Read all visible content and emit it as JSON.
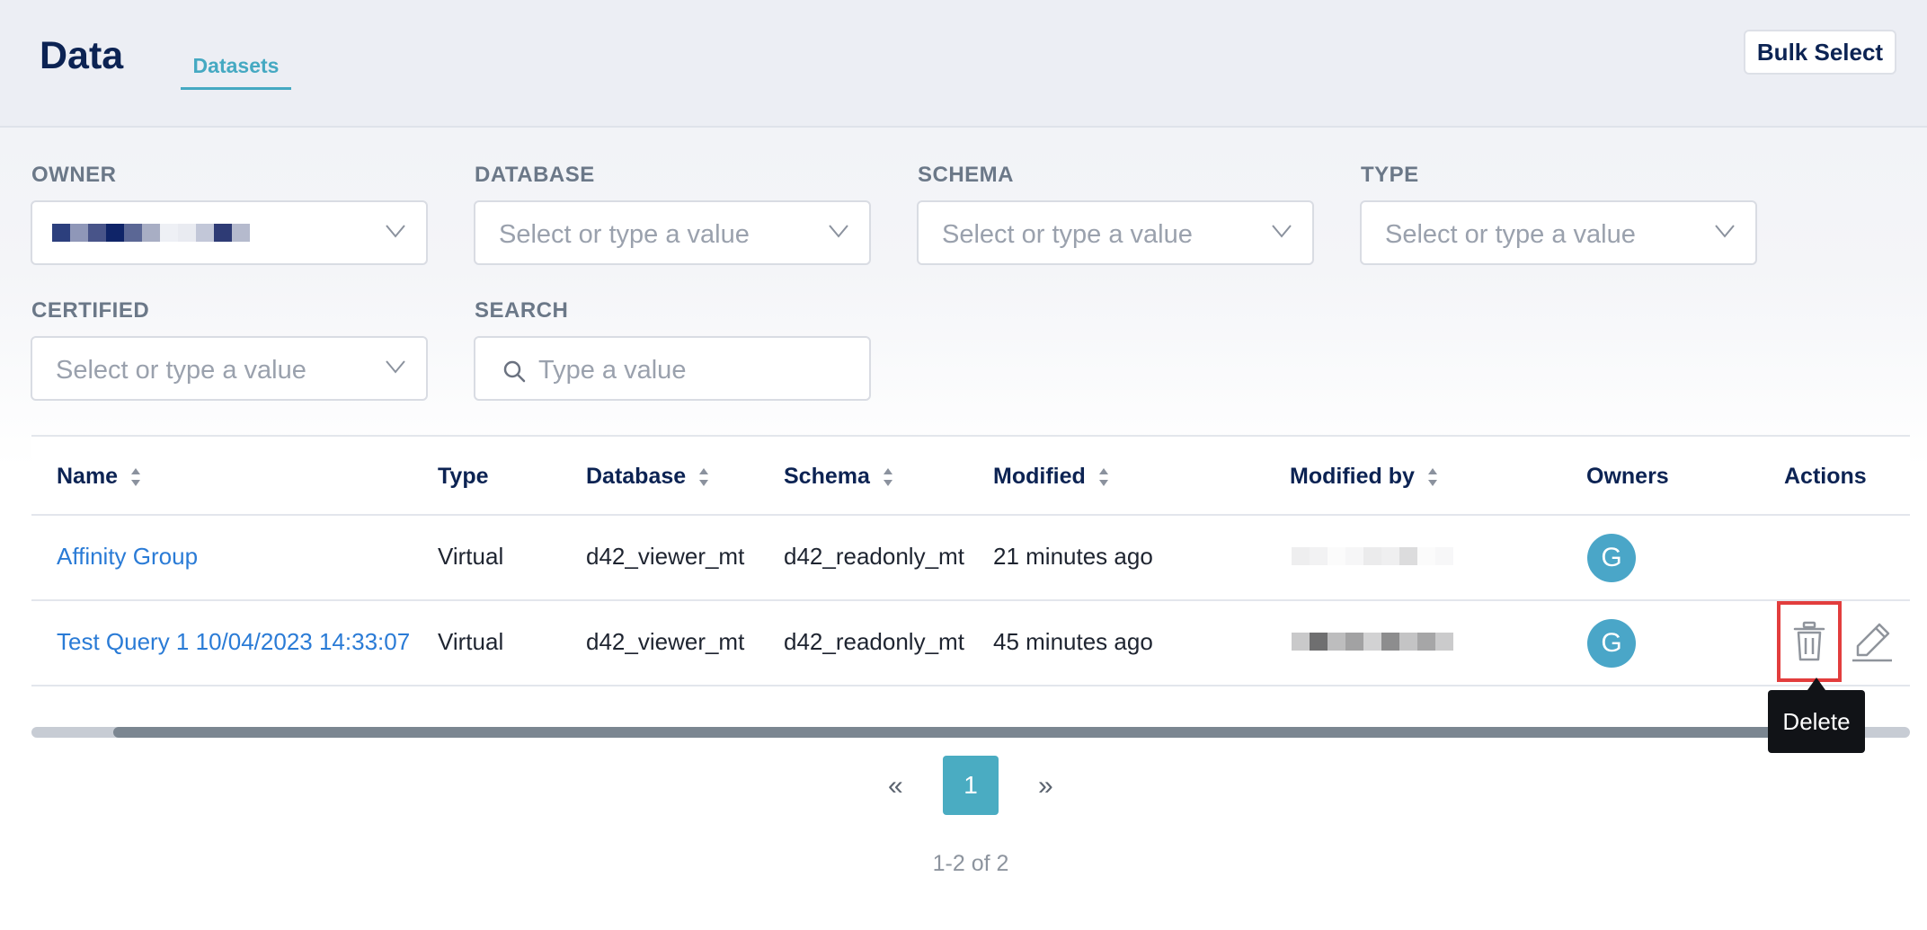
{
  "header": {
    "title": "Data",
    "tab": "Datasets",
    "bulk_select": "Bulk Select"
  },
  "filters": {
    "owner": {
      "label": "OWNER"
    },
    "database": {
      "label": "DATABASE",
      "placeholder": "Select or type a value"
    },
    "schema": {
      "label": "SCHEMA",
      "placeholder": "Select or type a value"
    },
    "type": {
      "label": "TYPE",
      "placeholder": "Select or type a value"
    },
    "certified": {
      "label": "CERTIFIED",
      "placeholder": "Select or type a value"
    },
    "search": {
      "label": "SEARCH",
      "placeholder": "Type a value"
    }
  },
  "table": {
    "columns": [
      "Name",
      "Type",
      "Database",
      "Schema",
      "Modified",
      "Modified by",
      "Owners",
      "Actions"
    ],
    "rows": [
      {
        "name": "Affinity Group",
        "type": "Virtual",
        "database": "d42_viewer_mt",
        "schema": "d42_readonly_mt",
        "modified": "21 minutes ago",
        "owner_initial": "G"
      },
      {
        "name": "Test Query 1 10/04/2023 14:33:07",
        "type": "Virtual",
        "database": "d42_viewer_mt",
        "schema": "d42_readonly_mt",
        "modified": "45 minutes ago",
        "owner_initial": "G"
      }
    ]
  },
  "tooltip": "Delete",
  "pagination": {
    "prev": "«",
    "current": "1",
    "next": "»",
    "summary": "1-2 of 2"
  },
  "colors": {
    "accent": "#45a9c2",
    "title": "#0c2353",
    "link": "#2a7bd6",
    "avatar": "#4aa6c8",
    "highlight": "#e23d3d"
  },
  "icons": [
    "chevron-down-icon",
    "search-icon",
    "sort-icon",
    "trash-icon",
    "pencil-icon"
  ]
}
